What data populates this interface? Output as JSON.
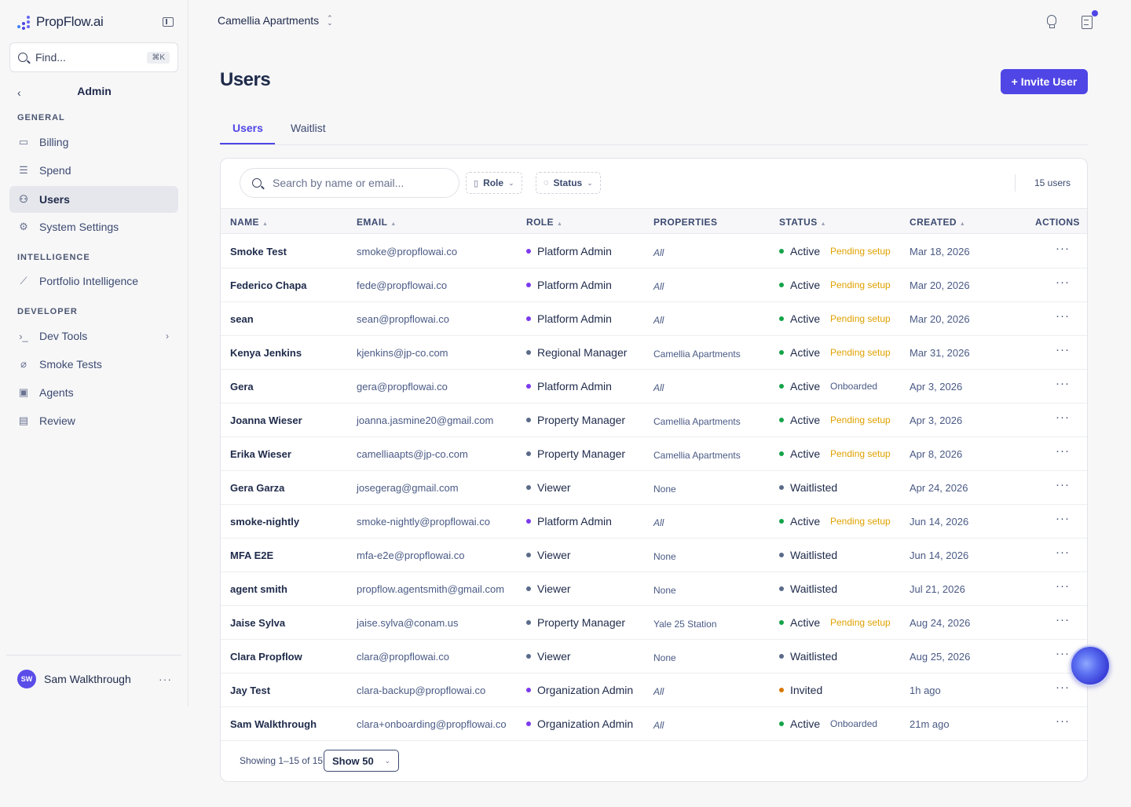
{
  "app": {
    "logo": "PropFlow.ai"
  },
  "sidebar": {
    "find_placeholder": "Find...",
    "find_shortcut": "⌘K",
    "section_title": "Admin",
    "sections": {
      "general": "GENERAL",
      "intelligence": "INTELLIGENCE",
      "developer": "DEVELOPER"
    },
    "items": {
      "billing": "Billing",
      "spend": "Spend",
      "users": "Users",
      "system_settings": "System Settings",
      "portfolio_intelligence": "Portfolio Intelligence",
      "dev_tools": "Dev Tools",
      "smoke_tests": "Smoke Tests",
      "agents": "Agents",
      "review": "Review"
    },
    "user": {
      "initials": "SW",
      "name": "Sam Walkthrough"
    }
  },
  "header": {
    "property": "Camellia Apartments"
  },
  "page": {
    "title": "Users",
    "invite_label": "+ Invite User",
    "tabs": {
      "users": "Users",
      "waitlist": "Waitlist"
    }
  },
  "toolbar": {
    "search_placeholder": "Search by name or email...",
    "role_filter": "Role",
    "status_filter": "Status",
    "count": "15 users"
  },
  "table": {
    "columns": {
      "name": "NAME",
      "email": "EMAIL",
      "role": "ROLE",
      "properties": "PROPERTIES",
      "status": "STATUS",
      "created": "CREATED",
      "actions": "ACTIONS"
    },
    "rows": [
      {
        "name": "Smoke Test",
        "email": "smoke@propflowai.co",
        "role": "Platform Admin",
        "properties": "All",
        "status": "Active",
        "badge": "Pending setup",
        "created": "Mar 18, 2026"
      },
      {
        "name": "Federico Chapa",
        "email": "fede@propflowai.co",
        "role": "Platform Admin",
        "properties": "All",
        "status": "Active",
        "badge": "Pending setup",
        "created": "Mar 20, 2026"
      },
      {
        "name": "sean",
        "email": "sean@propflowai.co",
        "role": "Platform Admin",
        "properties": "All",
        "status": "Active",
        "badge": "Pending setup",
        "created": "Mar 20, 2026"
      },
      {
        "name": "Kenya Jenkins",
        "email": "kjenkins@jp-co.com",
        "role": "Regional Manager",
        "properties": "Camellia Apartments",
        "status": "Active",
        "badge": "Pending setup",
        "created": "Mar 31, 2026"
      },
      {
        "name": "Gera",
        "email": "gera@propflowai.co",
        "role": "Platform Admin",
        "properties": "All",
        "status": "Active",
        "badge": "Onboarded",
        "created": "Apr 3, 2026"
      },
      {
        "name": "Joanna Wieser",
        "email": "joanna.jasmine20@gmail.com",
        "role": "Property Manager",
        "properties": "Camellia Apartments",
        "status": "Active",
        "badge": "Pending setup",
        "created": "Apr 3, 2026"
      },
      {
        "name": "Erika Wieser",
        "email": "camelliaapts@jp-co.com",
        "role": "Property Manager",
        "properties": "Camellia Apartments",
        "status": "Active",
        "badge": "Pending setup",
        "created": "Apr 8, 2026"
      },
      {
        "name": "Gera Garza",
        "email": "josegerag@gmail.com",
        "role": "Viewer",
        "properties": "None",
        "status": "Waitlisted",
        "badge": "",
        "created": "Apr 24, 2026"
      },
      {
        "name": "smoke-nightly",
        "email": "smoke-nightly@propflowai.co",
        "role": "Platform Admin",
        "properties": "All",
        "status": "Active",
        "badge": "Pending setup",
        "created": "Jun 14, 2026"
      },
      {
        "name": "MFA E2E",
        "email": "mfa-e2e@propflowai.co",
        "role": "Viewer",
        "properties": "None",
        "status": "Waitlisted",
        "badge": "",
        "created": "Jun 14, 2026"
      },
      {
        "name": "agent smith",
        "email": "propflow.agentsmith@gmail.com",
        "role": "Viewer",
        "properties": "None",
        "status": "Waitlisted",
        "badge": "",
        "created": "Jul 21, 2026"
      },
      {
        "name": "Jaise Sylva",
        "email": "jaise.sylva@conam.us",
        "role": "Property Manager",
        "properties": "Yale 25 Station",
        "status": "Active",
        "badge": "Pending setup",
        "created": "Aug 24, 2026"
      },
      {
        "name": "Clara Propflow",
        "email": "clara@propflowai.co",
        "role": "Viewer",
        "properties": "None",
        "status": "Waitlisted",
        "badge": "",
        "created": "Aug 25, 2026"
      },
      {
        "name": "Jay Test",
        "email": "clara-backup@propflowai.co",
        "role": "Organization Admin",
        "properties": "All",
        "status": "Invited",
        "badge": "",
        "created": "1h ago"
      },
      {
        "name": "Sam Walkthrough",
        "email": "clara+onboarding@propflowai.co",
        "role": "Organization Admin",
        "properties": "All",
        "status": "Active",
        "badge": "Onboarded",
        "created": "21m ago"
      }
    ]
  },
  "footer": {
    "showing": "Showing 1–15 of 15",
    "page_size": "Show 50"
  },
  "colors": {
    "accent": "#4f46e5",
    "role_admin": "#7c3aed",
    "role_other": "#5a6a8a",
    "status_active": "#16a34a",
    "status_waitlisted": "#5a6a8a",
    "status_invited": "#d97706",
    "badge_pending": "#e0a100",
    "badge_onboarded": "#4a5a85"
  }
}
